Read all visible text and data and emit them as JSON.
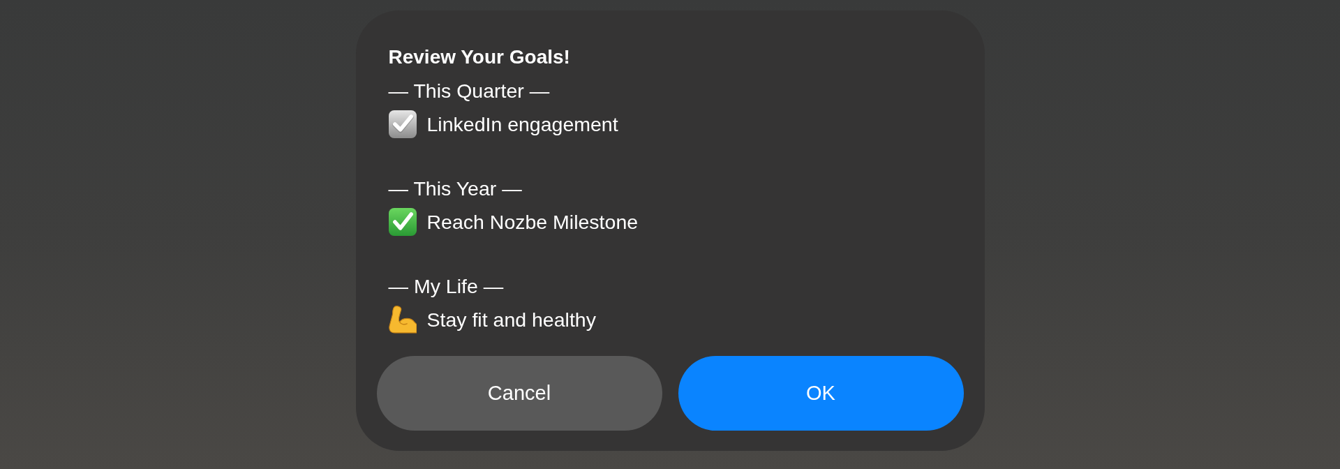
{
  "alert": {
    "title": "Review Your Goals!",
    "sections": [
      {
        "heading": "— This Quarter —",
        "items": [
          {
            "kind": "ballot",
            "text": "LinkedIn engagement"
          }
        ]
      },
      {
        "heading": "— This Year —",
        "items": [
          {
            "kind": "check",
            "text": "Reach Nozbe Milestone"
          }
        ]
      },
      {
        "heading": "— My Life —",
        "items": [
          {
            "kind": "muscle",
            "text": "Stay fit and healthy"
          }
        ]
      }
    ],
    "buttons": [
      {
        "kind": "cancel",
        "label": "Cancel"
      },
      {
        "kind": "default",
        "label": "OK"
      }
    ]
  }
}
